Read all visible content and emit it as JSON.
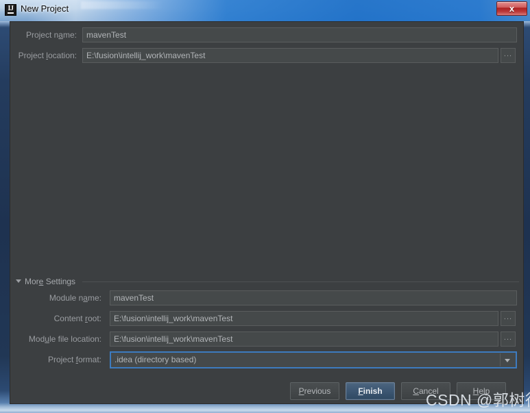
{
  "window": {
    "title": "New Project",
    "app_icon": "intellij-idea-icon",
    "close_label": "x"
  },
  "form": {
    "project_name": {
      "label_pre": "Project n",
      "label_accel": "a",
      "label_post": "me:",
      "value": "mavenTest"
    },
    "project_location": {
      "label_pre": "Project ",
      "label_accel": "l",
      "label_post": "ocation:",
      "value": "E:\\fusion\\intellij_work\\mavenTest",
      "browse_label": "..."
    }
  },
  "more_settings": {
    "label_pre": "Mor",
    "label_accel": "e",
    "label_post": " Settings",
    "expanded": true,
    "module_name": {
      "label_pre": "Module n",
      "label_accel": "a",
      "label_post": "me:",
      "value": "mavenTest"
    },
    "content_root": {
      "label_pre": "Content ",
      "label_accel": "r",
      "label_post": "oot:",
      "value": "E:\\fusion\\intellij_work\\mavenTest",
      "browse_label": "..."
    },
    "module_file_location": {
      "label_pre": "Mod",
      "label_accel": "u",
      "label_post": "le file location:",
      "value": "E:\\fusion\\intellij_work\\mavenTest",
      "browse_label": "..."
    },
    "project_format": {
      "label_pre": "Project ",
      "label_accel": "f",
      "label_post": "ormat:",
      "selected": ".idea (directory based)"
    }
  },
  "buttons": {
    "previous": {
      "pre": "",
      "accel": "P",
      "post": "revious"
    },
    "finish": {
      "pre": "",
      "accel": "F",
      "post": "inish"
    },
    "cancel": {
      "pre": "",
      "accel": "C",
      "post": "ancel"
    },
    "help": {
      "pre": "",
      "accel": "H",
      "post": "elp"
    }
  },
  "watermark": {
    "text": "CSDN @郭树行"
  },
  "colors": {
    "dialog_bg": "#3c3f41",
    "field_bg": "#45494a",
    "field_border": "#5a5d5e",
    "label_text": "#9a9da1",
    "value_text": "#b2b5b8",
    "focus_accent": "#3d7bbf",
    "default_button": "#3e5874",
    "close_red": "#ad2121",
    "titlebar_blue": "#2a7cd0"
  }
}
